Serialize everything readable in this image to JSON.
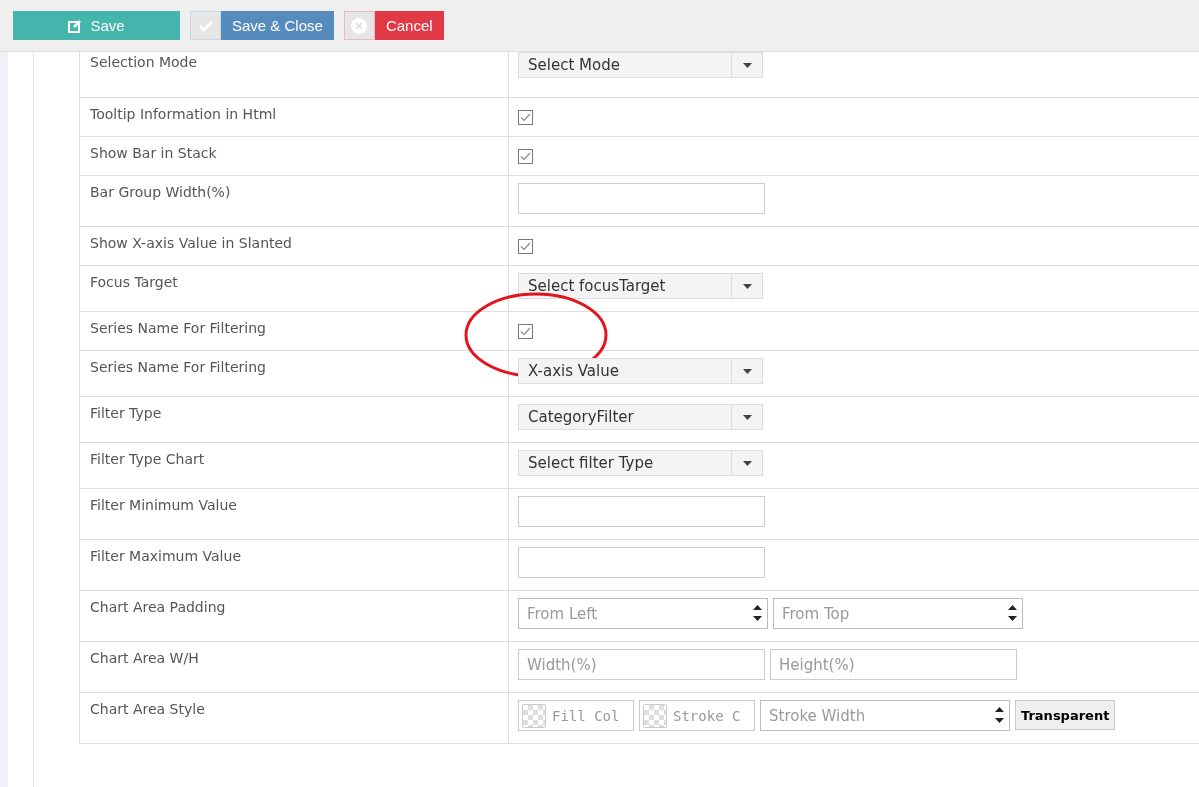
{
  "toolbar": {
    "buttons": [
      {
        "kind": "save",
        "label": "Save"
      },
      {
        "kind": "save-close",
        "label": "Save & Close"
      },
      {
        "kind": "cancel",
        "label": "Cancel"
      }
    ]
  },
  "rows": [
    {
      "label": "Selection Mode",
      "kind": "select",
      "value": "Select Mode"
    },
    {
      "label": "Tooltip Information in Html",
      "kind": "checkbox",
      "checked": true
    },
    {
      "label": "Show Bar in Stack",
      "kind": "checkbox",
      "checked": true
    },
    {
      "label": "Bar Group Width(%)",
      "kind": "input"
    },
    {
      "label": "Show X-axis Value in Slanted",
      "kind": "checkbox",
      "checked": true
    },
    {
      "label": "Focus Target",
      "kind": "select",
      "value": "Select focusTarget"
    },
    {
      "label": "Series Name For Filtering",
      "kind": "checkbox",
      "checked": true,
      "circled": true
    },
    {
      "label": "Series Name For Filtering",
      "kind": "select",
      "value": "X-axis Value"
    },
    {
      "label": "Filter Type",
      "kind": "select",
      "value": "CategoryFilter"
    },
    {
      "label": "Filter Type Chart",
      "kind": "select",
      "value": "Select filter Type"
    },
    {
      "label": "Filter Minimum Value",
      "kind": "input"
    },
    {
      "label": "Filter Maximum Value",
      "kind": "input"
    },
    {
      "label": "Chart Area Padding",
      "kind": "spin-pair",
      "placeholders": [
        "From Left",
        "From Top"
      ]
    },
    {
      "label": "Chart Area W/H",
      "kind": "input-pair",
      "placeholders": [
        "Width(%)",
        "Height(%)"
      ]
    },
    {
      "label": "Chart Area Style",
      "kind": "style",
      "placeholders": [
        "Fill Col",
        "Stroke C",
        "Stroke Width"
      ],
      "button": "Transparent"
    }
  ]
}
